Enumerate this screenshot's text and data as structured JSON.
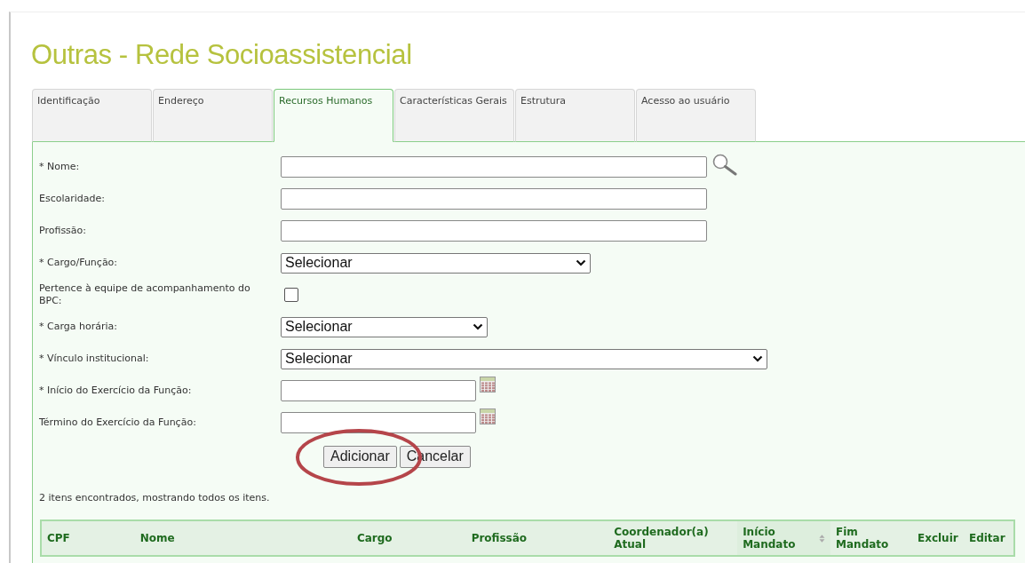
{
  "page": {
    "title": "Outras - Rede Socioassistencial"
  },
  "tabs": [
    {
      "label": "Identificação",
      "selected": false
    },
    {
      "label": "Endereço",
      "selected": false
    },
    {
      "label": "Recursos Humanos",
      "selected": true
    },
    {
      "label": "Características Gerais",
      "selected": false
    },
    {
      "label": "Estrutura",
      "selected": false
    },
    {
      "label": "Acesso ao usuário",
      "selected": false
    }
  ],
  "form": {
    "fields": [
      {
        "kind": "search",
        "label": "* Nome:"
      },
      {
        "kind": "text",
        "label": "Escolaridade:"
      },
      {
        "kind": "text",
        "label": "Profissão:"
      },
      {
        "kind": "select",
        "label": "* Cargo/Função:",
        "value": "Selecionar"
      },
      {
        "kind": "checkbox",
        "label": "Pertence à equipe de acompanhamento do BPC:",
        "checked": false
      },
      {
        "kind": "select",
        "label": "* Carga horária:",
        "value": "Selecionar"
      },
      {
        "kind": "select",
        "label": "* Vínculo institucional:",
        "value": "Selecionar"
      },
      {
        "kind": "date",
        "label": "* Início do Exercício da Função:"
      },
      {
        "kind": "date",
        "label": "Término do Exercício da Função:"
      }
    ],
    "buttons": [
      {
        "label": "Adicionar",
        "circled": true
      },
      {
        "label": "Cancelar",
        "circled": false
      }
    ]
  },
  "results": {
    "summary": "2 itens encontrados, mostrando todos os itens.",
    "columns": [
      {
        "label": "CPF",
        "sortable": false
      },
      {
        "label": "Nome",
        "sortable": false
      },
      {
        "label": "Cargo",
        "sortable": false
      },
      {
        "label": "Profissão",
        "sortable": false
      },
      {
        "label": "Coordenador(a) Atual",
        "sortable": false
      },
      {
        "label": "Início Mandato",
        "sortable": true
      },
      {
        "label": "Fim Mandato",
        "sortable": false
      },
      {
        "label": "Excluir",
        "sortable": false
      },
      {
        "label": "Editar",
        "sortable": false
      }
    ]
  }
}
